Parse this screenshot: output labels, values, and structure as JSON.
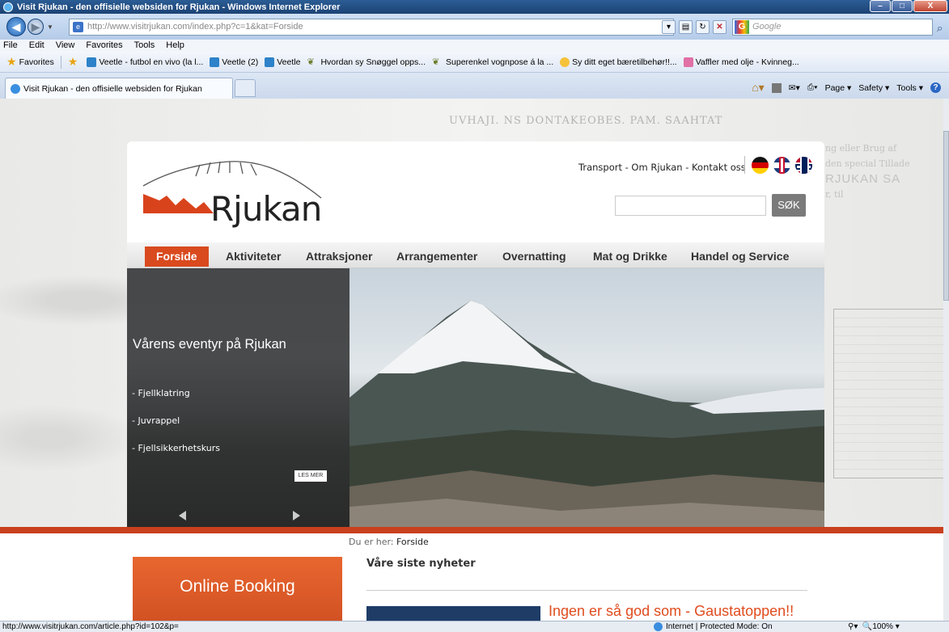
{
  "window": {
    "title": "Visit Rjukan - den offisielle websiden for Rjukan - Windows Internet Explorer",
    "buttons": {
      "minimize": "–",
      "maximize": "□",
      "close": "X"
    }
  },
  "address": {
    "url_host": "http://www.visitrjukan.com",
    "url_path": "/index.php?c=1&kat=Forside",
    "search_placeholder": "Google"
  },
  "menu": [
    "File",
    "Edit",
    "View",
    "Favorites",
    "Tools",
    "Help"
  ],
  "favorites": {
    "label": "Favorites",
    "items": [
      {
        "label": "Veetle - futbol en vivo (la l...",
        "icon": "blue"
      },
      {
        "label": "Veetle (2)",
        "icon": "blue"
      },
      {
        "label": "Veetle",
        "icon": "blue"
      },
      {
        "label": "Hvordan sy Snøggel opps...",
        "icon": "sheep"
      },
      {
        "label": "Superenkel vognpose á la ...",
        "icon": "sheep"
      },
      {
        "label": "Sy ditt eget bæretilbehør!!...",
        "icon": "yellow"
      },
      {
        "label": "Vaffler med olje - Kvinneg...",
        "icon": "pink"
      }
    ]
  },
  "tab": {
    "label": "Visit Rjukan - den offisielle websiden for Rjukan"
  },
  "commands": {
    "page": "Page",
    "safety": "Safety",
    "tools": "Tools"
  },
  "site": {
    "logo_text": "Rjukan",
    "toplinks": "Transport - Om Rjukan - Kontakt oss",
    "search_button": "SØK",
    "nav": [
      {
        "label": "Forside",
        "active": true
      },
      {
        "label": "Aktiviteter"
      },
      {
        "label": "Attraksjoner"
      },
      {
        "label": "Arrangementer"
      },
      {
        "label": "Overnatting"
      },
      {
        "label": "Mat og Drikke"
      },
      {
        "label": "Handel og Service"
      }
    ],
    "hero": {
      "title": "Vårens eventyr på Rjukan",
      "items": [
        "- Fjellklatring",
        "- Juvrappel",
        "- Fjellsikkerhetskurs"
      ],
      "more": "LES MER"
    },
    "booking": "Online Booking",
    "breadcrumb_prefix": "Du er her:",
    "breadcrumb_page": "Forside",
    "news_title": "Våre siste nyheter",
    "news_headline": "Ingen er så god som - Gaustatoppen!!"
  },
  "background": {
    "top_text": "UVHAJI. NS DONTAKEOBES. PAM. SAAHTAT",
    "right_text": [
      "ng eller Brug af",
      "den special Tillade",
      "RJUKAN SA",
      "r, til"
    ]
  },
  "status": {
    "url": "http://www.visitrjukan.com/article.php?id=102&p=",
    "zone": "Internet | Protected Mode: On",
    "zoom": "100%"
  }
}
